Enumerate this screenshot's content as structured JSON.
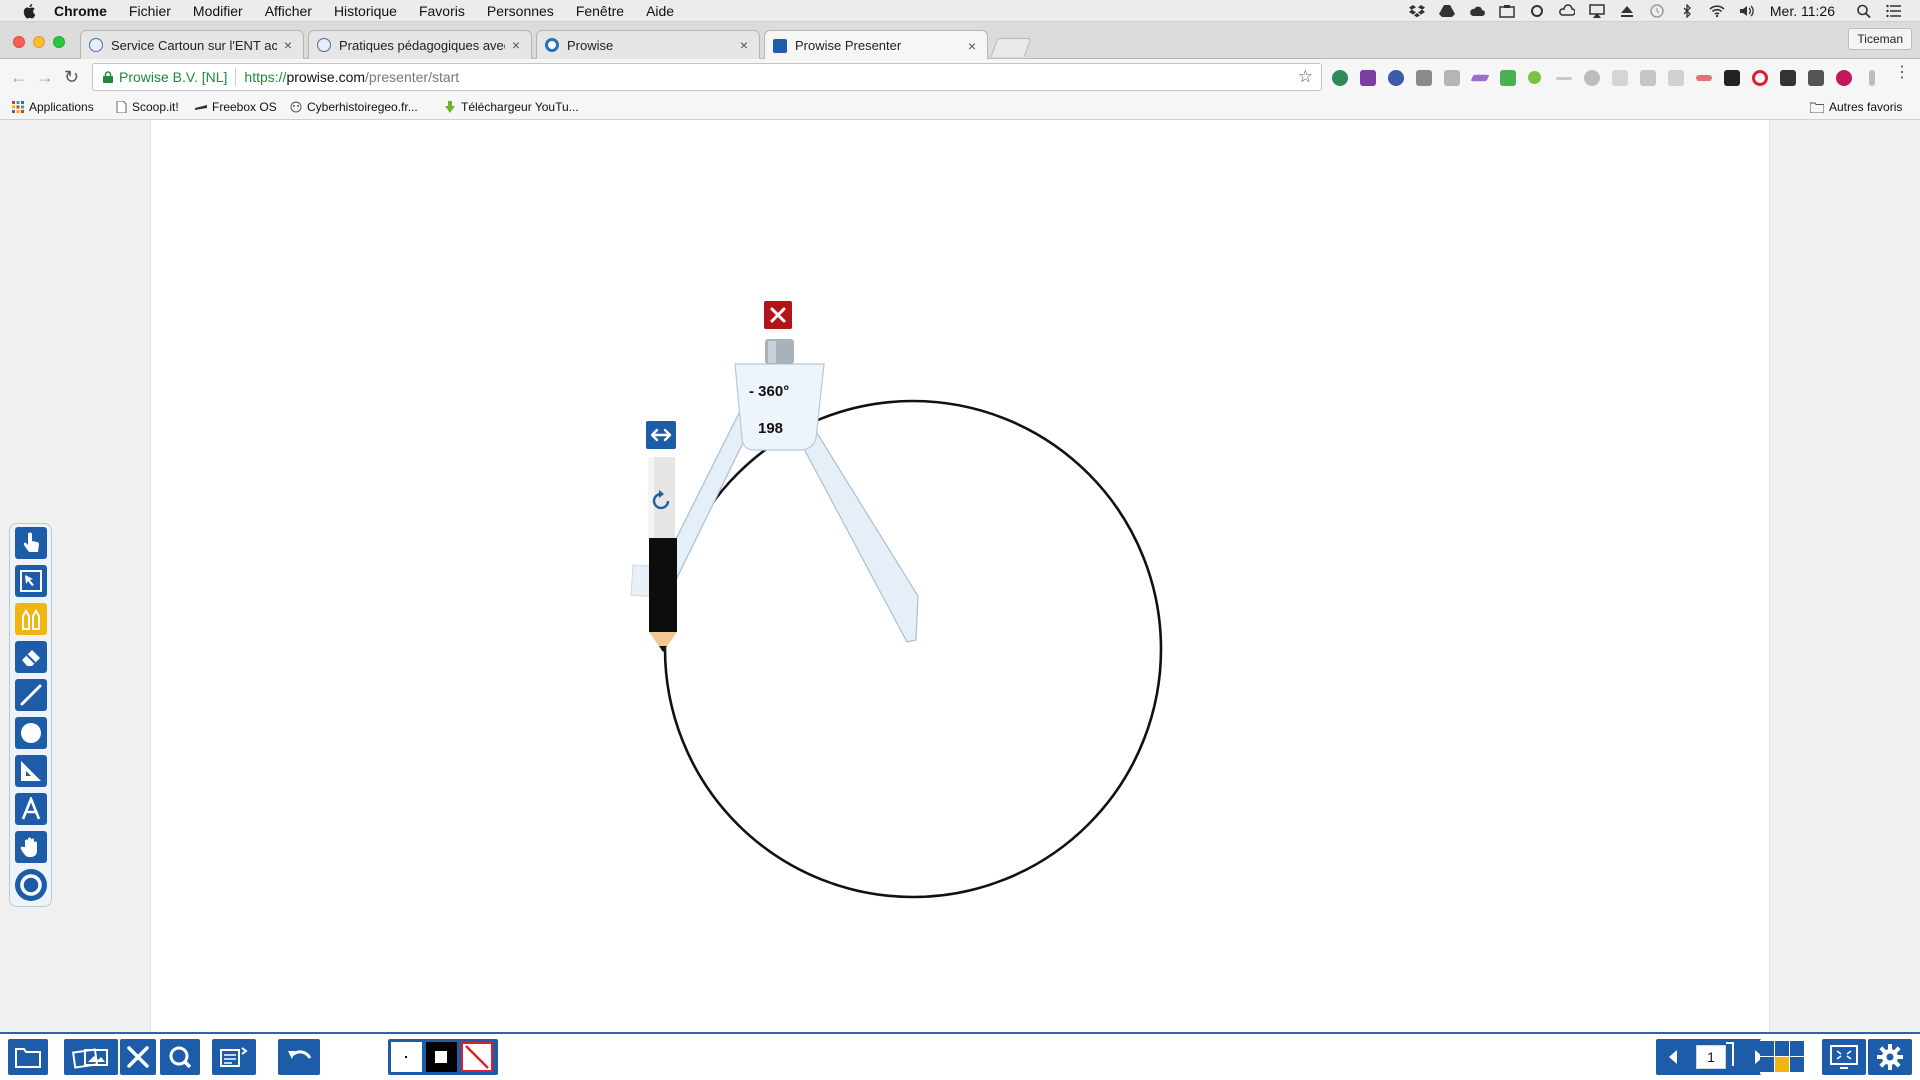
{
  "menubar": {
    "app_name": "Chrome",
    "items": [
      "Fichier",
      "Modifier",
      "Afficher",
      "Historique",
      "Favoris",
      "Personnes",
      "Fenêtre",
      "Aide"
    ],
    "clock": "Mer. 11:26"
  },
  "tabs": [
    {
      "title": "Service Cartoun sur l'ENT aca",
      "active": false
    },
    {
      "title": "Pratiques pédagogiques avec l",
      "active": false
    },
    {
      "title": "Prowise",
      "active": false
    },
    {
      "title": "Prowise Presenter",
      "active": true
    }
  ],
  "profile": {
    "name": "Ticeman"
  },
  "omnibox": {
    "site_identity": "Prowise B.V. [NL]",
    "url_scheme": "https://",
    "url_host": "prowise.com",
    "url_path": "/presenter/start"
  },
  "bookmarks": {
    "items": [
      "Applications",
      "Scoop.it!",
      "Freebox OS",
      "Cyberhistoiregeo.fr...",
      "Téléchargeur YouTu..."
    ],
    "other": "Autres favoris"
  },
  "compass": {
    "angle_label": "- 360°",
    "radius_label": "198"
  },
  "page_indicator": "1",
  "colors": {
    "tool_blue": "#1d5ca8",
    "tool_active": "#f2b50f",
    "compass_close": "#b3141c",
    "secure_green": "#1f8a3b"
  }
}
